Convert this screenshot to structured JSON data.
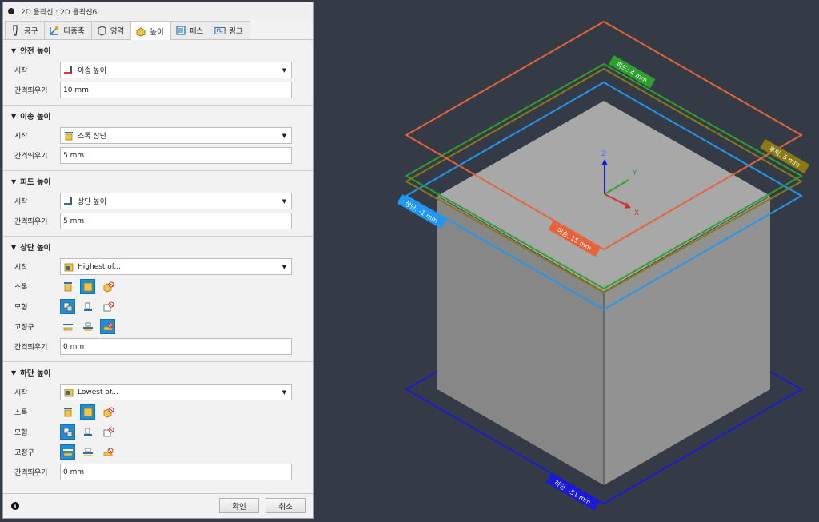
{
  "window": {
    "title": "2D 윤곽선 : 2D 윤곽선6"
  },
  "tabs": [
    {
      "label": "공구",
      "icon": "tool-icon"
    },
    {
      "label": "다중축",
      "icon": "multiaxis-icon"
    },
    {
      "label": "영역",
      "icon": "geometry-icon"
    },
    {
      "label": "높이",
      "icon": "heights-icon",
      "active": true
    },
    {
      "label": "패스",
      "icon": "passes-icon"
    },
    {
      "label": "링크",
      "icon": "linking-icon"
    }
  ],
  "sections": {
    "safe": {
      "title": "안전 높이",
      "from_label": "시작",
      "from_value": "이송 높이",
      "offset_label": "간격띄우기",
      "offset_value": "10 mm"
    },
    "feed": {
      "title": "이송 높이",
      "from_label": "시작",
      "from_value": "스톡 상단",
      "offset_label": "간격띄우기",
      "offset_value": "5 mm"
    },
    "plunge": {
      "title": "피드 높이",
      "from_label": "시작",
      "from_value": "상단 높이",
      "offset_label": "간격띄우기",
      "offset_value": "5 mm"
    },
    "top": {
      "title": "상단 높이",
      "from_label": "시작",
      "from_value": "Highest of...",
      "stock_label": "스톡",
      "model_label": "모형",
      "fixture_label": "고정구",
      "offset_label": "간격띄우기",
      "offset_value": "0 mm"
    },
    "bottom": {
      "title": "하단 높이",
      "from_label": "시작",
      "from_value": "Lowest of...",
      "stock_label": "스톡",
      "model_label": "모형",
      "fixture_label": "고정구",
      "offset_label": "간격띄우기",
      "offset_value": "0 mm"
    }
  },
  "footer": {
    "ok_label": "확인",
    "cancel_label": "취소"
  },
  "viewport": {
    "labels": {
      "clearance": "이송: 15 mm",
      "retract": "후퇴: 5 mm",
      "feed": "피드: 4 mm",
      "top": "상단: -1 mm",
      "bottom": "하단: -51 mm"
    },
    "axes": {
      "z": "Z",
      "y": "Y",
      "x": "X"
    },
    "colors": {
      "background": "#343b46",
      "clearance": "#e8623a",
      "retract": "#8a7a14",
      "feed": "#2fa02f",
      "top": "#2196f3",
      "bottom": "#1a1ad6",
      "selected": "#1e8fd6"
    }
  }
}
